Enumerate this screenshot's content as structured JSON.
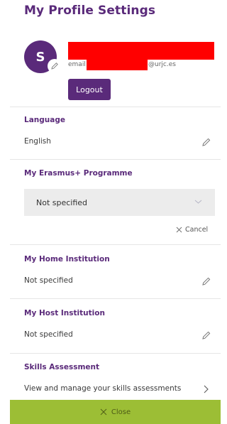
{
  "page": {
    "title": "My Profile Settings"
  },
  "profile": {
    "avatar_initial": "S",
    "email_prefix": "email",
    "email_suffix": "@urjc.es",
    "logout_label": "Logout"
  },
  "sections": {
    "language": {
      "title": "Language",
      "value": "English"
    },
    "erasmus": {
      "title": "My Erasmus+ Programme",
      "select_value": "Not specified",
      "cancel_label": "Cancel"
    },
    "home_institution": {
      "title": "My Home Institution",
      "value": "Not specified"
    },
    "host_institution": {
      "title": "My Host Institution",
      "value": "Not specified"
    },
    "skills": {
      "title": "Skills Assessment",
      "link_label": "View and manage your skills assessments"
    }
  },
  "footer": {
    "close_label": "Close"
  },
  "colors": {
    "brand_purple": "#5a2a7a",
    "close_green": "#9cbe35",
    "redaction": "#ff0000"
  }
}
